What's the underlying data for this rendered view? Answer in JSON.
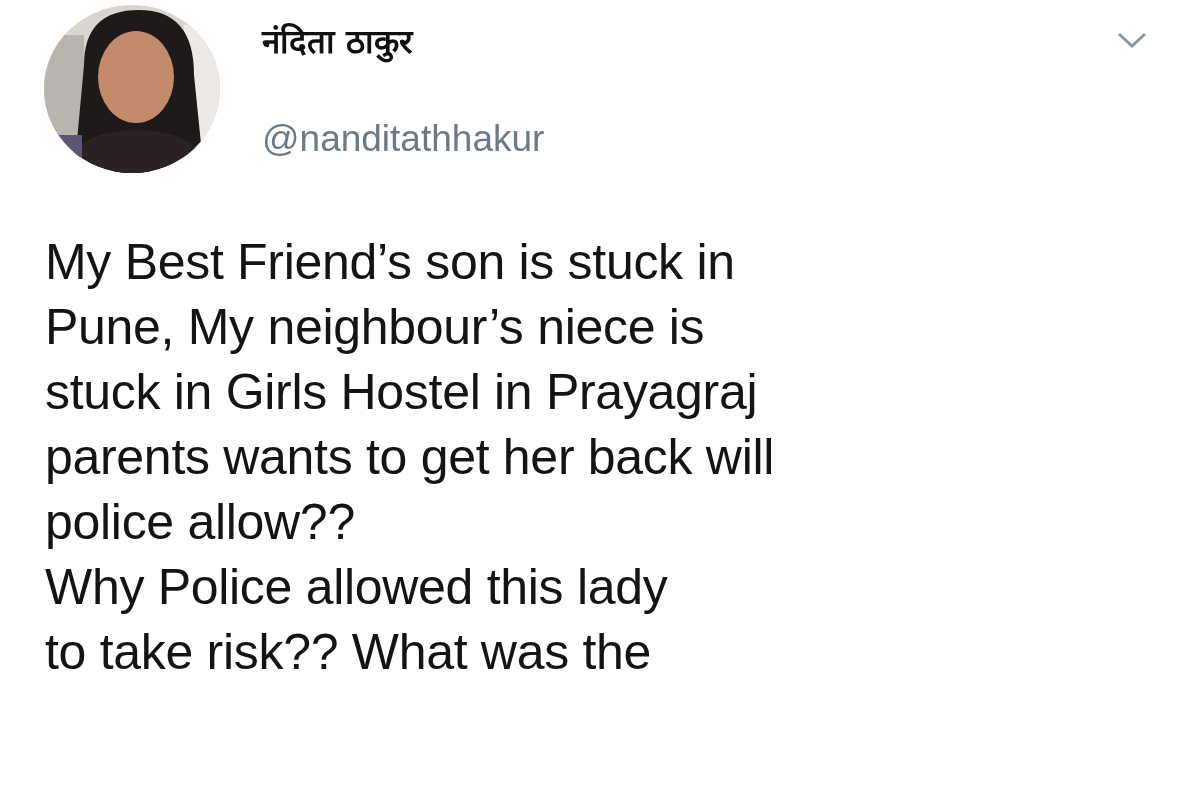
{
  "author": {
    "name": "नंदिता ठाकुर",
    "handle": "@nanditathhakur"
  },
  "tweet": {
    "lines": [
      "My Best Friend’s son is stuck in",
      "Pune, My neighbour’s niece is",
      "stuck in Girls Hostel in Prayagraj",
      "parents wants to get her back will",
      "police allow??",
      "Why Police allowed this lady",
      "to take risk?? What was the"
    ]
  }
}
